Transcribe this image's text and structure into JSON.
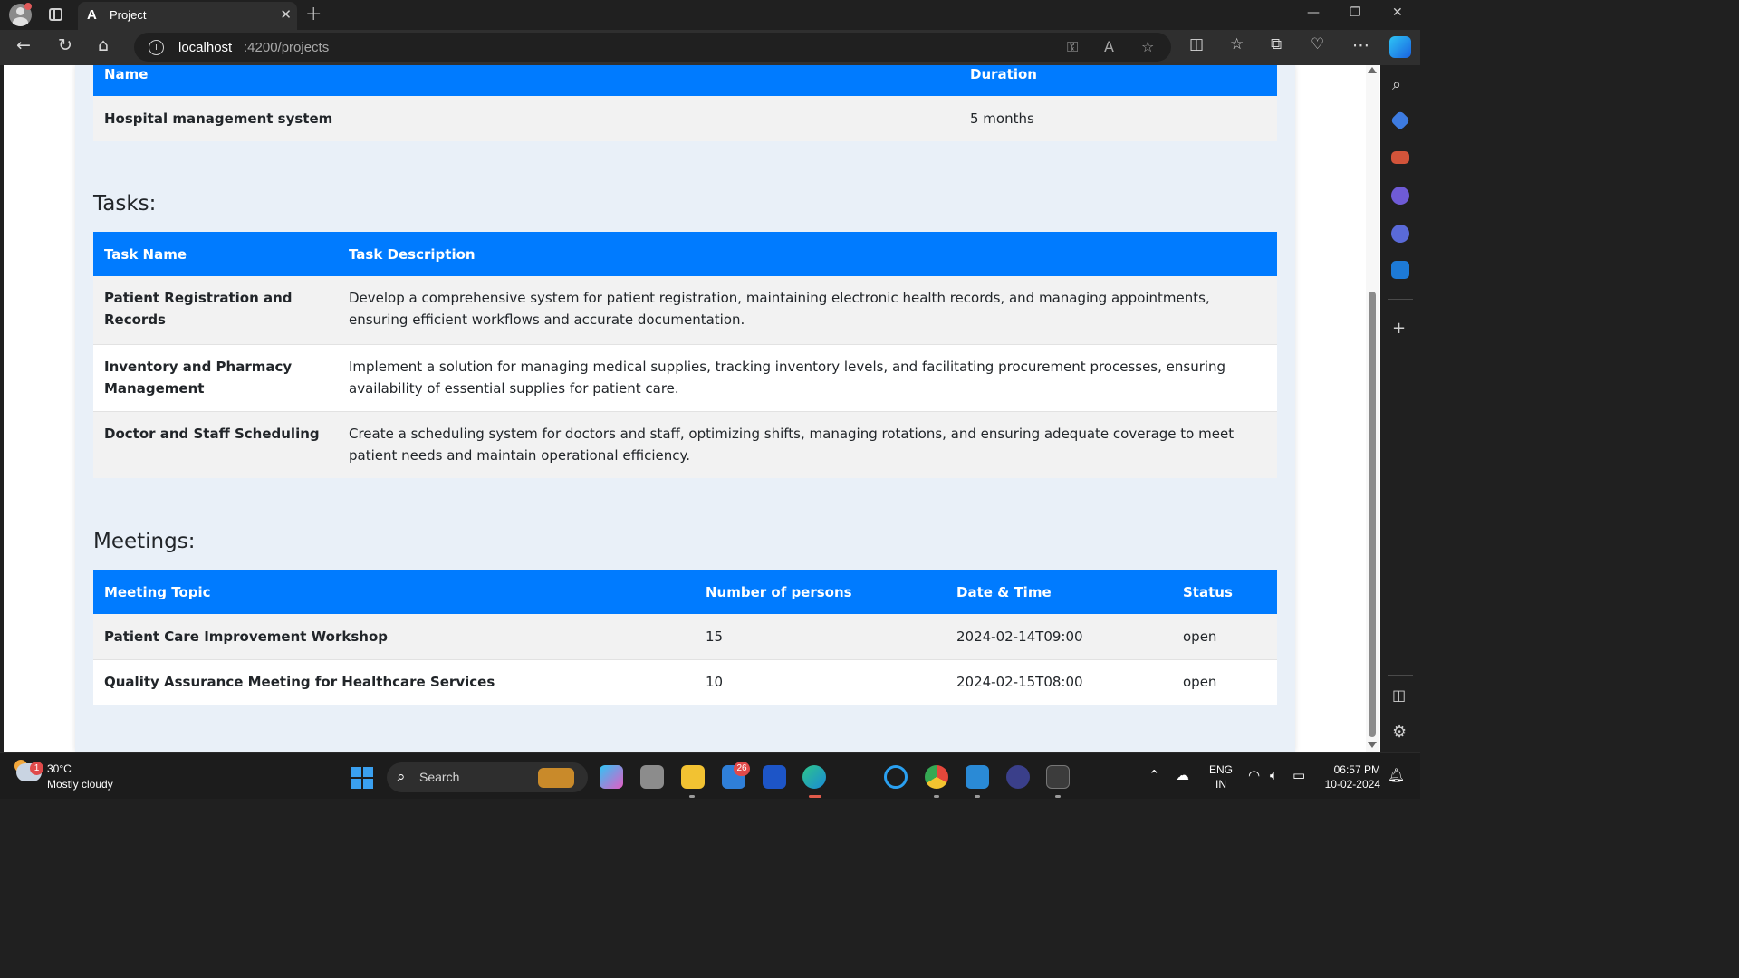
{
  "browser": {
    "tab_title": "Project",
    "tab_favicon": "A",
    "url_host": "localhost",
    "url_path": ":4200/projects"
  },
  "project_table": {
    "headers": [
      "Name",
      "Duration"
    ],
    "rows": [
      [
        "Hospital management system",
        "5 months"
      ]
    ]
  },
  "tasks": {
    "title": "Tasks:",
    "headers": [
      "Task Name",
      "Task Description"
    ],
    "rows": [
      [
        "Patient Registration and Records",
        "Develop a comprehensive system for patient registration, maintaining electronic health records, and managing appointments, ensuring efficient workflows and accurate documentation."
      ],
      [
        "Inventory and Pharmacy Management",
        "Implement a solution for managing medical supplies, tracking inventory levels, and facilitating procurement processes, ensuring availability of essential supplies for patient care."
      ],
      [
        "Doctor and Staff Scheduling",
        "Create a scheduling system for doctors and staff, optimizing shifts, managing rotations, and ensuring adequate coverage to meet patient needs and maintain operational efficiency."
      ]
    ]
  },
  "meetings": {
    "title": "Meetings:",
    "headers": [
      "Meeting Topic",
      "Number of persons",
      "Date & Time",
      "Status"
    ],
    "rows": [
      [
        "Patient Care Improvement Workshop",
        "15",
        "2024-02-14T09:00",
        "open"
      ],
      [
        "Quality Assurance Meeting for Healthcare Services",
        "10",
        "2024-02-15T08:00",
        "open"
      ]
    ]
  },
  "taskbar": {
    "weather_temp": "30°C",
    "weather_condition": "Mostly cloudy",
    "weather_badge": "1",
    "search_label": "Search",
    "mail_badge": "26",
    "lang_line1": "ENG",
    "lang_line2": "IN",
    "time": "06:57 PM",
    "date": "10-02-2024"
  },
  "colors": {
    "table_header": "#007bff",
    "page_background": "#e9f0f8",
    "row_stripe": "#f2f2f2"
  },
  "icons": [
    "profile-avatar-icon",
    "tab-actions-icon",
    "back-icon",
    "refresh-icon",
    "home-icon",
    "info-icon",
    "key-icon",
    "read-aloud-icon",
    "favorite-star-icon",
    "split-screen-icon",
    "favorites-icon",
    "collections-icon",
    "browser-essentials-icon",
    "more-icon",
    "copilot-icon",
    "windows-start-icon",
    "search-icon",
    "wifi-icon",
    "volume-icon",
    "battery-icon",
    "notification-bell-icon"
  ]
}
